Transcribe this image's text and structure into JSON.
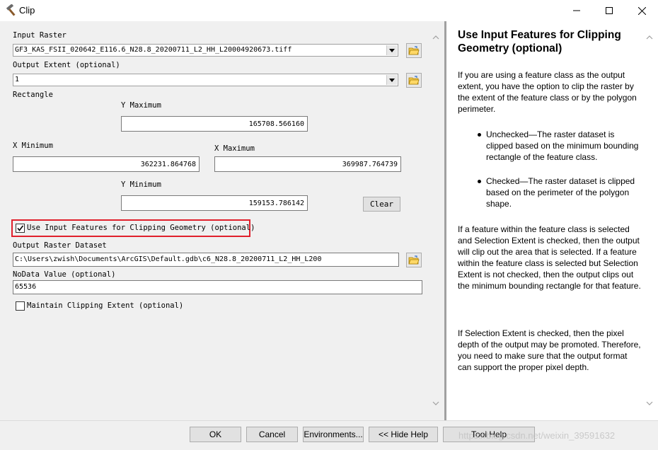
{
  "window": {
    "title": "Clip"
  },
  "form": {
    "input_raster": {
      "label": "Input Raster",
      "value": "GF3_KAS_FSII_020642_E116.6_N28.8_20200711_L2_HH_L20004920673.tiff"
    },
    "output_extent": {
      "label": "Output Extent (optional)",
      "value": "1"
    },
    "rectangle": {
      "label": "Rectangle",
      "y_max_label": "Y Maximum",
      "y_max": "165708.566160",
      "x_min_label": "X Minimum",
      "x_min": "362231.864768",
      "x_max_label": "X Maximum",
      "x_max": "369987.764739",
      "y_min_label": "Y Minimum",
      "y_min": "159153.786142",
      "clear_label": "Clear"
    },
    "use_input_features": {
      "label": "Use Input Features for Clipping Geometry (optional)",
      "checked": true
    },
    "output_raster": {
      "label": "Output Raster Dataset",
      "value": "C:\\Users\\zwish\\Documents\\ArcGIS\\Default.gdb\\c6_N28.8_20200711_L2_HH_L200"
    },
    "nodata": {
      "label": "NoData Value (optional)",
      "value": "65536"
    },
    "maintain_extent": {
      "label": "Maintain Clipping Extent (optional)",
      "checked": false
    }
  },
  "help": {
    "title": "Use Input Features for Clipping Geometry (optional)",
    "intro": "If you are using a feature class as the output extent, you have the option to clip the raster by the extent of the feature class or by the polygon perimeter.",
    "bullets": [
      "Unchecked—The raster dataset is clipped based on the minimum bounding rectangle of the feature class.",
      "Checked—The raster dataset is clipped based on the perimeter of the polygon shape."
    ],
    "para2": "If a feature within the feature class is selected and Selection Extent is checked, then the output will clip out the area that is selected. If a feature within the feature class is selected but Selection Extent is not checked, then the output clips out the minimum bounding rectangle for that feature.",
    "para3": "If Selection Extent is checked, then the pixel depth of the output may be promoted. Therefore, you need to make sure that the output format can support the proper pixel depth."
  },
  "buttons": {
    "ok": "OK",
    "cancel": "Cancel",
    "environments": "Environments...",
    "hide_help": "<< Hide Help",
    "tool_help": "Tool Help"
  },
  "watermark": "https://blog.csdn.net/weixin_39591632",
  "colors": {
    "highlight_border": "#e0202c",
    "window_bg": "#f0f0f0",
    "help_bg": "#ffffff"
  }
}
